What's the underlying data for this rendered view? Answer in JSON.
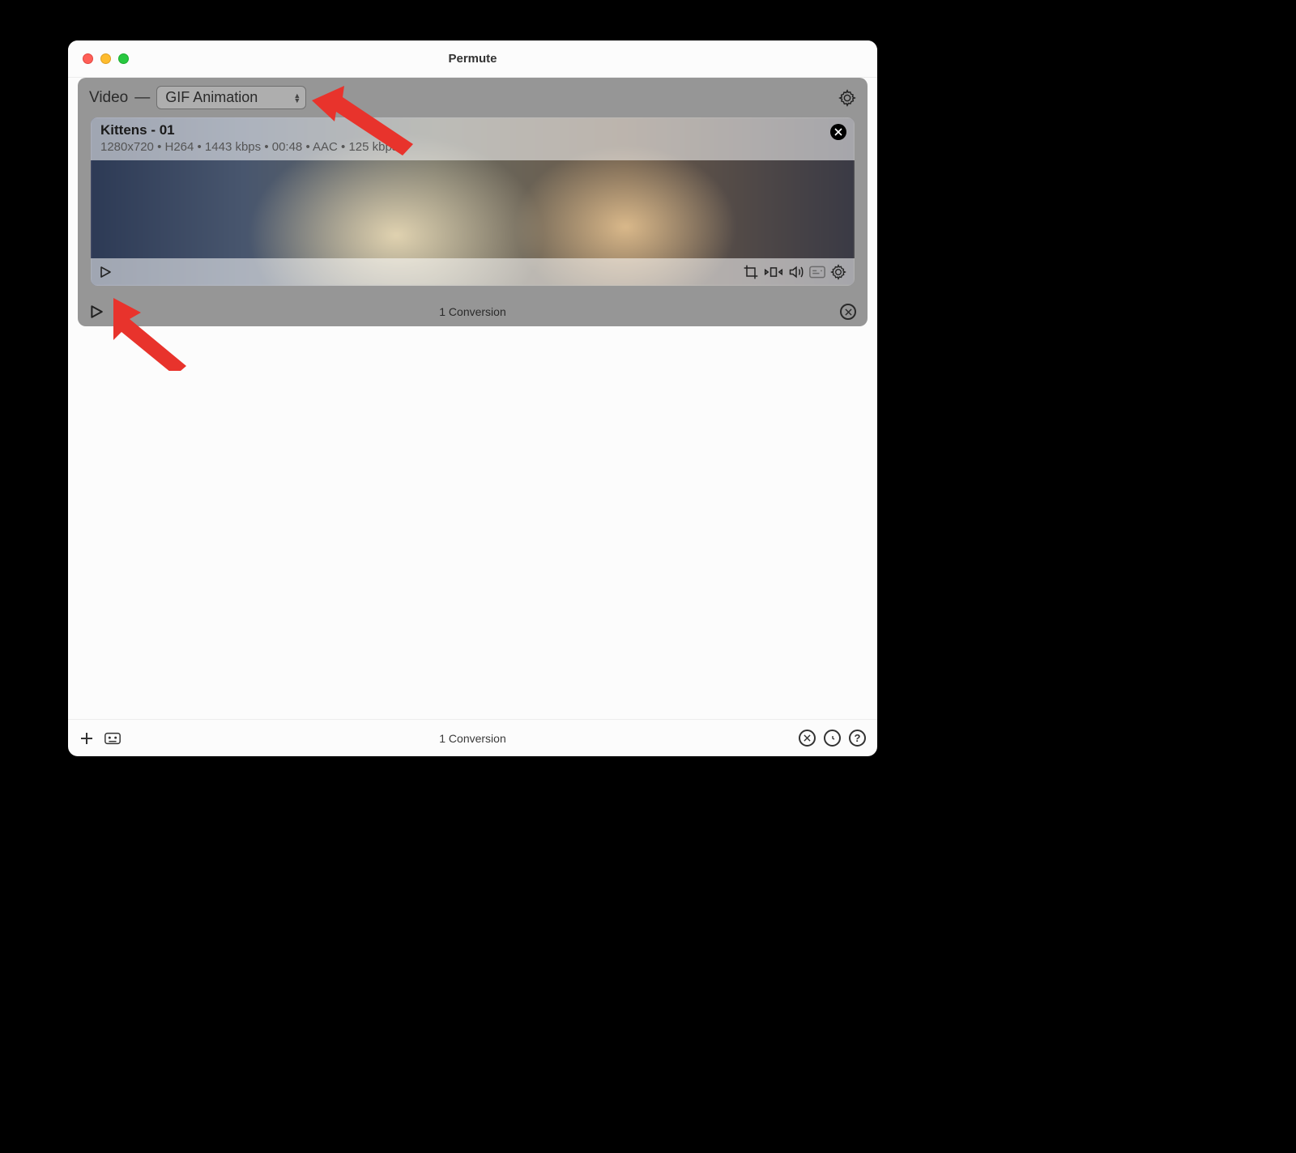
{
  "window": {
    "title": "Permute"
  },
  "panel": {
    "category": "Video",
    "format": "GIF Animation",
    "footer_status": "1 Conversion"
  },
  "item": {
    "title": "Kittens - 01",
    "meta": "1280x720 • H264 • 1443 kbps • 00:48 • AAC • 125 kbps"
  },
  "footer": {
    "status": "1 Conversion"
  }
}
